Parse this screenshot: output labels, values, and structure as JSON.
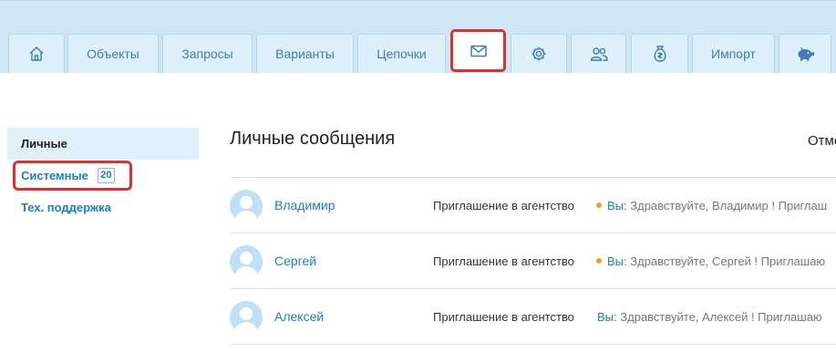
{
  "nav": {
    "tabs": [
      {
        "icon": "home-icon"
      },
      {
        "label": "Объекты"
      },
      {
        "label": "Запросы"
      },
      {
        "label": "Варианты"
      },
      {
        "label": "Цепочки"
      },
      {
        "icon": "envelope-icon",
        "active": true
      },
      {
        "icon": "gear-icon"
      },
      {
        "icon": "users-icon"
      },
      {
        "icon": "money-bag-icon"
      },
      {
        "label": "Импорт"
      },
      {
        "icon": "piggy-bank-icon"
      }
    ]
  },
  "sidebar": {
    "items": [
      {
        "label": "Личные"
      },
      {
        "label": "Системные",
        "badge": "20"
      },
      {
        "label": "Тех. поддержка"
      }
    ]
  },
  "main": {
    "title": "Личные сообщения",
    "mark_all_label": "Отме",
    "messages": [
      {
        "sender": "Владимир",
        "subject": "Приглашение в агентство",
        "unread": true,
        "you_prefix": "Вы:",
        "preview": "Здравствуйте, Владимир ! Приглаш"
      },
      {
        "sender": "Сергей",
        "subject": "Приглашение в агентство",
        "unread": true,
        "you_prefix": "Вы:",
        "preview": "Здравствуйте, Сергей ! Приглашаю"
      },
      {
        "sender": "Алексей",
        "subject": "Приглашение в агентство",
        "unread": false,
        "you_prefix": "Вы:",
        "preview": "Здравствуйте, Алексей ! Приглашаю"
      }
    ]
  },
  "colors": {
    "accent": "#1a7fc4",
    "highlight_border": "#d9312b",
    "nav_bg": "#cfe7f4",
    "unread_dot": "#f2a316"
  }
}
